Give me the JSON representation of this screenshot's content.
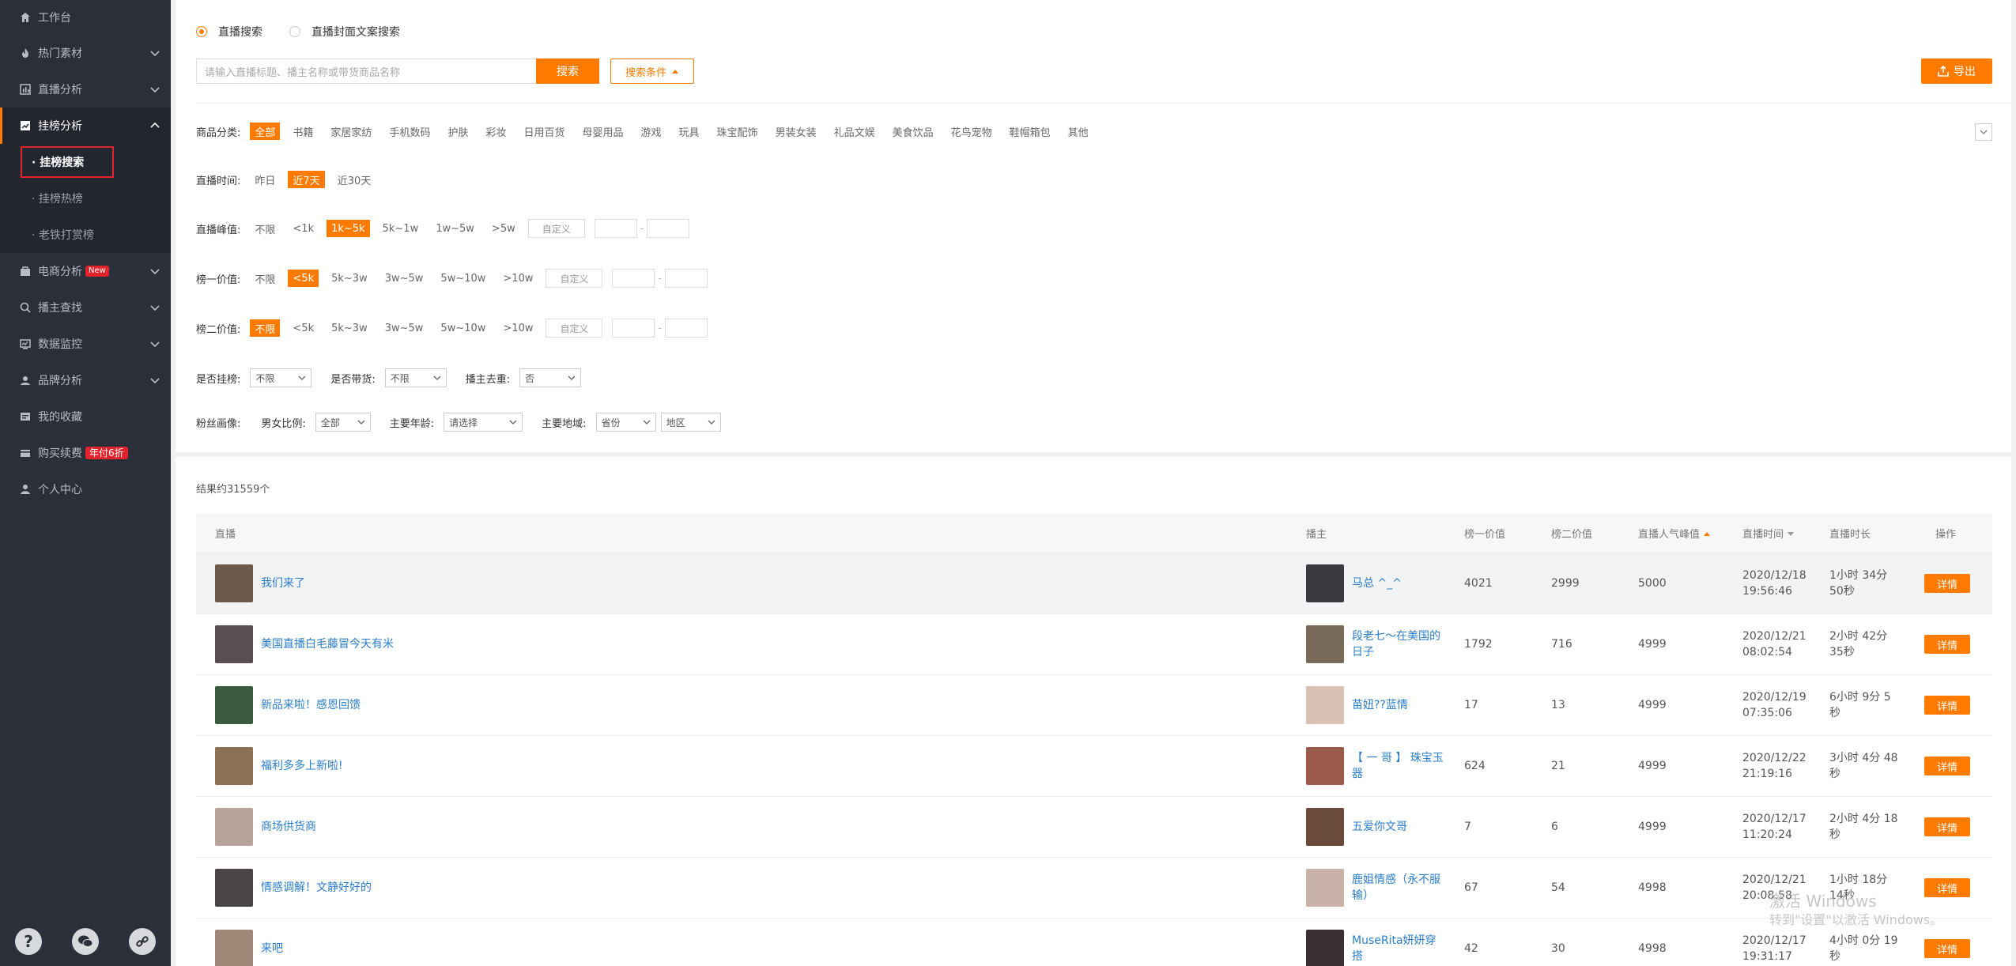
{
  "sidebar": {
    "items": [
      {
        "label": "工作台",
        "icon": "home-icon"
      },
      {
        "label": "热门素材",
        "icon": "fire-icon"
      },
      {
        "label": "直播分析",
        "icon": "bar-chart-icon"
      },
      {
        "label": "挂榜分析",
        "icon": "line-chart-icon"
      },
      {
        "label": "电商分析",
        "icon": "shop-icon",
        "badge": "New"
      },
      {
        "label": "播主查找",
        "icon": "search-icon"
      },
      {
        "label": "数据监控",
        "icon": "monitor-icon"
      },
      {
        "label": "品牌分析",
        "icon": "brand-icon"
      },
      {
        "label": "我的收藏",
        "icon": "favorite-icon"
      },
      {
        "label": "购买续费",
        "icon": "card-icon",
        "badge": "年付6折"
      },
      {
        "label": "个人中心",
        "icon": "user-icon"
      }
    ],
    "sub_items": [
      "挂榜搜索",
      "挂榜热榜",
      "老铁打赏榜"
    ]
  },
  "search": {
    "radio1": "直播搜索",
    "radio2": "直播封面文案搜索",
    "placeholder": "请输入直播标题、播主名称或带货商品名称",
    "search_btn": "搜索",
    "cond_btn": "搜索条件",
    "export_btn": "导出"
  },
  "filters": {
    "category_label": "商品分类:",
    "categories": [
      "全部",
      "书籍",
      "家居家纺",
      "手机数码",
      "护肤",
      "彩妆",
      "日用百货",
      "母婴用品",
      "游戏",
      "玩具",
      "珠宝配饰",
      "男装女装",
      "礼品文娱",
      "美食饮品",
      "花鸟宠物",
      "鞋帽箱包",
      "其他"
    ],
    "time_label": "直播时间:",
    "times": [
      "昨日",
      "近7天",
      "近30天"
    ],
    "peak_label": "直播峰值:",
    "peaks": [
      "不限",
      "<1k",
      "1k~5k",
      "5k~1w",
      "1w~5w",
      ">5w"
    ],
    "rank1_label": "榜一价值:",
    "rank1": [
      "不限",
      "<5k",
      "5k~3w",
      "3w~5w",
      "5w~10w",
      ">10w"
    ],
    "rank2_label": "榜二价值:",
    "rank2": [
      "不限",
      "<5k",
      "5k~3w",
      "3w~5w",
      "5w~10w",
      ">10w"
    ],
    "custom": "自定义",
    "is_rank_label": "是否挂榜:",
    "is_rank_val": "不限",
    "is_goods_label": "是否带货:",
    "is_goods_val": "不限",
    "dedup_label": "播主去重:",
    "dedup_val": "否",
    "fans_label": "粉丝画像:",
    "gender_label": "男女比例:",
    "gender_val": "全部",
    "age_label": "主要年龄:",
    "age_val": "请选择",
    "region_label": "主要地域:",
    "province_val": "省份",
    "area_val": "地区"
  },
  "results": {
    "count": "结果约31559个",
    "headers": {
      "live": "直播",
      "host": "播主",
      "rank1": "榜一价值",
      "rank2": "榜二价值",
      "peak": "直播人气峰值",
      "time": "直播时间",
      "duration": "直播时长",
      "action": "操作"
    },
    "detail_label": "详情",
    "rows": [
      {
        "title": "我们来了",
        "host": "马总 ^_^",
        "rank1": "4021",
        "rank2": "2999",
        "peak": "5000",
        "date": "2020/12/18",
        "clock": "19:56:46",
        "dur1": "1小时 34分",
        "dur2": "50秒",
        "c1": "#6b5a4a",
        "c2": "#3b3a40"
      },
      {
        "title": "美国直播白毛藤冒今天有米",
        "host": "段老七～在美国的日子",
        "rank1": "1792",
        "rank2": "716",
        "peak": "4999",
        "date": "2020/12/21",
        "clock": "08:02:54",
        "dur1": "2小时 42分",
        "dur2": "35秒",
        "c1": "#5a4f55",
        "c2": "#7a6a5a"
      },
      {
        "title": "新品来啦！感恩回馈",
        "host": "苗妞??蓝情",
        "rank1": "17",
        "rank2": "13",
        "peak": "4999",
        "date": "2020/12/19",
        "clock": "07:35:06",
        "dur1": "6小时 9分 5",
        "dur2": "秒",
        "c1": "#3c5a3f",
        "c2": "#d9c2b5"
      },
      {
        "title": "福利多多上新啦!",
        "host": "【 一 哥 】 珠宝玉器",
        "rank1": "624",
        "rank2": "21",
        "peak": "4999",
        "date": "2020/12/22",
        "clock": "21:19:16",
        "dur1": "3小时 4分 48",
        "dur2": "秒",
        "c1": "#8a7055",
        "c2": "#9a5a4a"
      },
      {
        "title": "商场供货商",
        "host": "五爱你文哥",
        "rank1": "7",
        "rank2": "6",
        "peak": "4999",
        "date": "2020/12/17",
        "clock": "11:20:24",
        "dur1": "2小时 4分 18",
        "dur2": "秒",
        "c1": "#b8a49a",
        "c2": "#6a4a3a"
      },
      {
        "title": "情感调解！文静好好的",
        "host": "鹿姐情感（永不服输）",
        "rank1": "67",
        "rank2": "54",
        "peak": "4998",
        "date": "2020/12/21",
        "clock": "20:08:58",
        "dur1": "1小时 18分",
        "dur2": "14秒",
        "c1": "#4a4448",
        "c2": "#c9b3a8"
      },
      {
        "title": "来吧",
        "host": "MuseRita妍妍穿搭",
        "rank1": "42",
        "rank2": "30",
        "peak": "4998",
        "date": "2020/12/17",
        "clock": "19:31:17",
        "dur1": "4小时 0分 19",
        "dur2": "秒",
        "c1": "#a08878",
        "c2": "#3a3034"
      }
    ]
  },
  "watermark": {
    "line1": "激活 Windows",
    "line2": "转到\"设置\"以激活 Windows。"
  },
  "colors": {
    "accent": "#ff7b00",
    "sidebar": "#2b2f3a",
    "link": "#2a7dc8"
  }
}
